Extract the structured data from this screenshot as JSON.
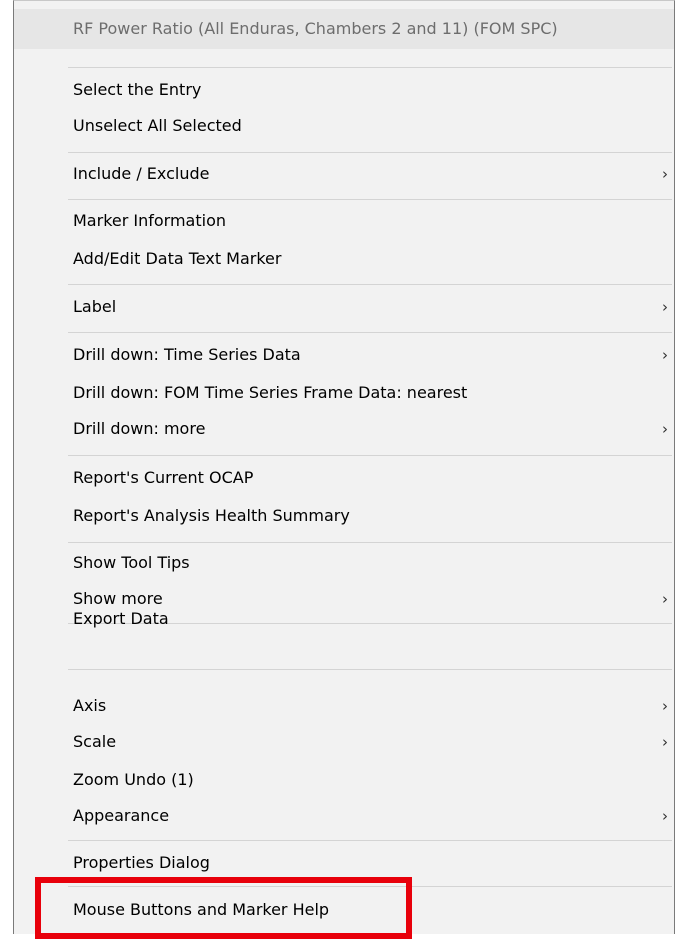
{
  "menu": {
    "title": "RF Power Ratio (All Enduras, Chambers 2 and 11) (FOM SPC)",
    "arrow_glyph": "›",
    "items": [
      {
        "label": "Select the Entry"
      },
      {
        "label": "Unselect All Selected"
      },
      {
        "label": "Include / Exclude",
        "submenu": true
      },
      {
        "label": "Marker Information"
      },
      {
        "label": "Add/Edit Data Text Marker"
      },
      {
        "label": "Label",
        "submenu": true
      },
      {
        "label": "Drill down: Time Series Data",
        "submenu": true
      },
      {
        "label": "Drill down: FOM Time Series Frame Data: nearest"
      },
      {
        "label": "Drill down: more",
        "submenu": true
      },
      {
        "label": "Report's Current OCAP"
      },
      {
        "label": "Report's Analysis Health Summary"
      },
      {
        "label": "Show Tool Tips"
      },
      {
        "label": "Show more",
        "submenu": true
      },
      {
        "label": "Export Data"
      },
      {
        "label": "Axis",
        "submenu": true
      },
      {
        "label": "Scale",
        "submenu": true
      },
      {
        "label": "Zoom Undo (1)"
      },
      {
        "label": "Appearance",
        "submenu": true
      },
      {
        "label": "Properties Dialog"
      },
      {
        "label": "Mouse Buttons and Marker Help"
      }
    ]
  },
  "highlight": {
    "color": "#e8000b",
    "target": "Mouse Buttons and Marker Help"
  }
}
